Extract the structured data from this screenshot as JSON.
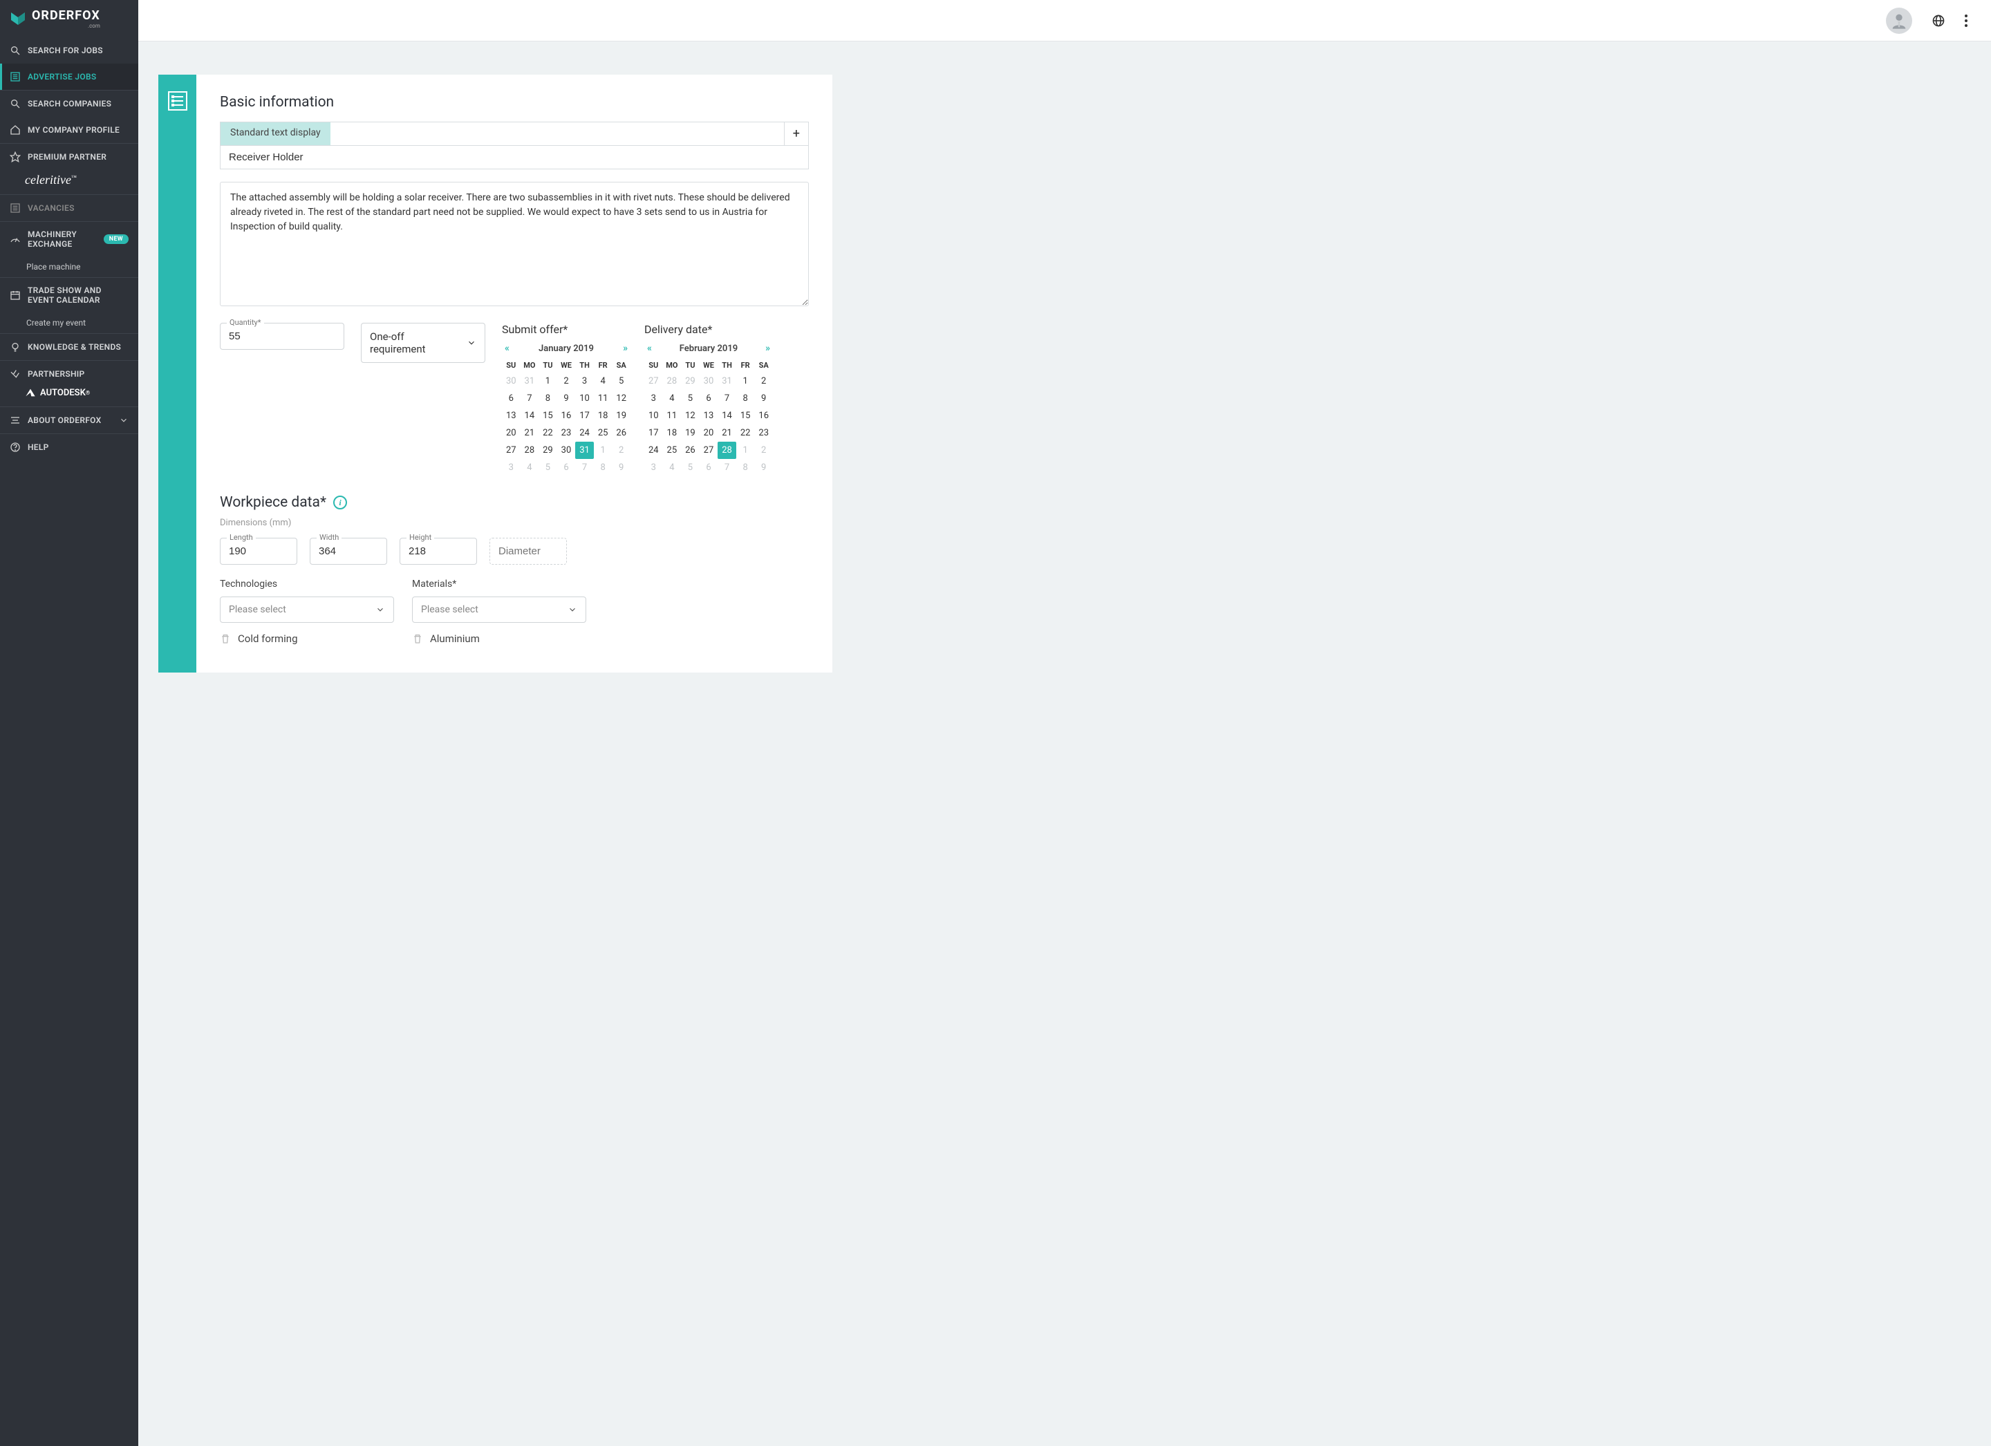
{
  "brand": {
    "name": "ORDERFOX",
    "tag": ".com"
  },
  "sidebar": {
    "items": [
      {
        "label": "SEARCH FOR JOBS",
        "icon": "search"
      },
      {
        "label": "ADVERTISE JOBS",
        "icon": "list",
        "active": true
      },
      {
        "label": "SEARCH COMPANIES",
        "icon": "search"
      },
      {
        "label": "MY COMPANY PROFILE",
        "icon": "home"
      }
    ],
    "premium_label": "PREMIUM PARTNER",
    "premium_brand": "celeritive",
    "vacancies_label": "VACANCIES",
    "machinery_label": "MACHINERY EXCHANGE",
    "new_badge": "NEW",
    "place_machine": "Place machine",
    "tradeshow_label": "TRADE SHOW AND EVENT CALENDAR",
    "create_event": "Create my event",
    "knowledge_label": "KNOWLEDGE & TRENDS",
    "partnership_label": "PARTNERSHIP",
    "autodesk": "AUTODESK",
    "about_label": "ABOUT ORDERFOX",
    "help_label": "HELP"
  },
  "form": {
    "section_title": "Basic information",
    "tab_label": "Standard text display",
    "title_value": "Receiver Holder",
    "description": "The attached assembly will be holding a solar receiver. There are two subassemblies in it with rivet nuts. These should be delivered already riveted in. The rest of the standard part need not be supplied. We would expect to have 3 sets send to us in Austria for Inspection of build quality.",
    "quantity_label": "Quantity*",
    "quantity_value": "55",
    "requirement_value": "One-off requirement",
    "submit_offer": {
      "title": "Submit offer*",
      "month": "January 2019",
      "dows": [
        "SU",
        "MO",
        "TU",
        "WE",
        "TH",
        "FR",
        "SA"
      ],
      "rows": [
        [
          {
            "d": "30",
            "o": true
          },
          {
            "d": "31",
            "o": true
          },
          {
            "d": "1"
          },
          {
            "d": "2"
          },
          {
            "d": "3"
          },
          {
            "d": "4"
          },
          {
            "d": "5"
          }
        ],
        [
          {
            "d": "6"
          },
          {
            "d": "7"
          },
          {
            "d": "8"
          },
          {
            "d": "9"
          },
          {
            "d": "10"
          },
          {
            "d": "11"
          },
          {
            "d": "12"
          }
        ],
        [
          {
            "d": "13"
          },
          {
            "d": "14"
          },
          {
            "d": "15"
          },
          {
            "d": "16"
          },
          {
            "d": "17"
          },
          {
            "d": "18"
          },
          {
            "d": "19"
          }
        ],
        [
          {
            "d": "20"
          },
          {
            "d": "21"
          },
          {
            "d": "22"
          },
          {
            "d": "23"
          },
          {
            "d": "24"
          },
          {
            "d": "25"
          },
          {
            "d": "26"
          }
        ],
        [
          {
            "d": "27"
          },
          {
            "d": "28"
          },
          {
            "d": "29"
          },
          {
            "d": "30"
          },
          {
            "d": "31",
            "sel": true
          },
          {
            "d": "1",
            "o": true
          },
          {
            "d": "2",
            "o": true
          }
        ],
        [
          {
            "d": "3",
            "o": true
          },
          {
            "d": "4",
            "o": true
          },
          {
            "d": "5",
            "o": true
          },
          {
            "d": "6",
            "o": true
          },
          {
            "d": "7",
            "o": true
          },
          {
            "d": "8",
            "o": true
          },
          {
            "d": "9",
            "o": true
          }
        ]
      ]
    },
    "delivery": {
      "title": "Delivery date*",
      "month": "February 2019",
      "dows": [
        "SU",
        "MO",
        "TU",
        "WE",
        "TH",
        "FR",
        "SA"
      ],
      "rows": [
        [
          {
            "d": "27",
            "o": true
          },
          {
            "d": "28",
            "o": true
          },
          {
            "d": "29",
            "o": true
          },
          {
            "d": "30",
            "o": true
          },
          {
            "d": "31",
            "o": true
          },
          {
            "d": "1"
          },
          {
            "d": "2"
          }
        ],
        [
          {
            "d": "3"
          },
          {
            "d": "4"
          },
          {
            "d": "5"
          },
          {
            "d": "6"
          },
          {
            "d": "7"
          },
          {
            "d": "8"
          },
          {
            "d": "9"
          }
        ],
        [
          {
            "d": "10"
          },
          {
            "d": "11"
          },
          {
            "d": "12"
          },
          {
            "d": "13"
          },
          {
            "d": "14"
          },
          {
            "d": "15"
          },
          {
            "d": "16"
          }
        ],
        [
          {
            "d": "17"
          },
          {
            "d": "18"
          },
          {
            "d": "19"
          },
          {
            "d": "20"
          },
          {
            "d": "21"
          },
          {
            "d": "22"
          },
          {
            "d": "23"
          }
        ],
        [
          {
            "d": "24"
          },
          {
            "d": "25"
          },
          {
            "d": "26"
          },
          {
            "d": "27"
          },
          {
            "d": "28",
            "sel": true
          },
          {
            "d": "1",
            "o": true
          },
          {
            "d": "2",
            "o": true
          }
        ],
        [
          {
            "d": "3",
            "o": true
          },
          {
            "d": "4",
            "o": true
          },
          {
            "d": "5",
            "o": true
          },
          {
            "d": "6",
            "o": true
          },
          {
            "d": "7",
            "o": true
          },
          {
            "d": "8",
            "o": true
          },
          {
            "d": "9",
            "o": true
          }
        ]
      ]
    },
    "workpiece_title": "Workpiece data*",
    "dims_label": "Dimensions (mm)",
    "length_label": "Length",
    "length_value": "190",
    "width_label": "Width",
    "width_value": "364",
    "height_label": "Height",
    "height_value": "218",
    "diameter_placeholder": "Diameter",
    "tech_label": "Technologies",
    "materials_label": "Materials*",
    "please_select": "Please select",
    "tech_chip": "Cold forming",
    "material_chip": "Aluminium"
  }
}
